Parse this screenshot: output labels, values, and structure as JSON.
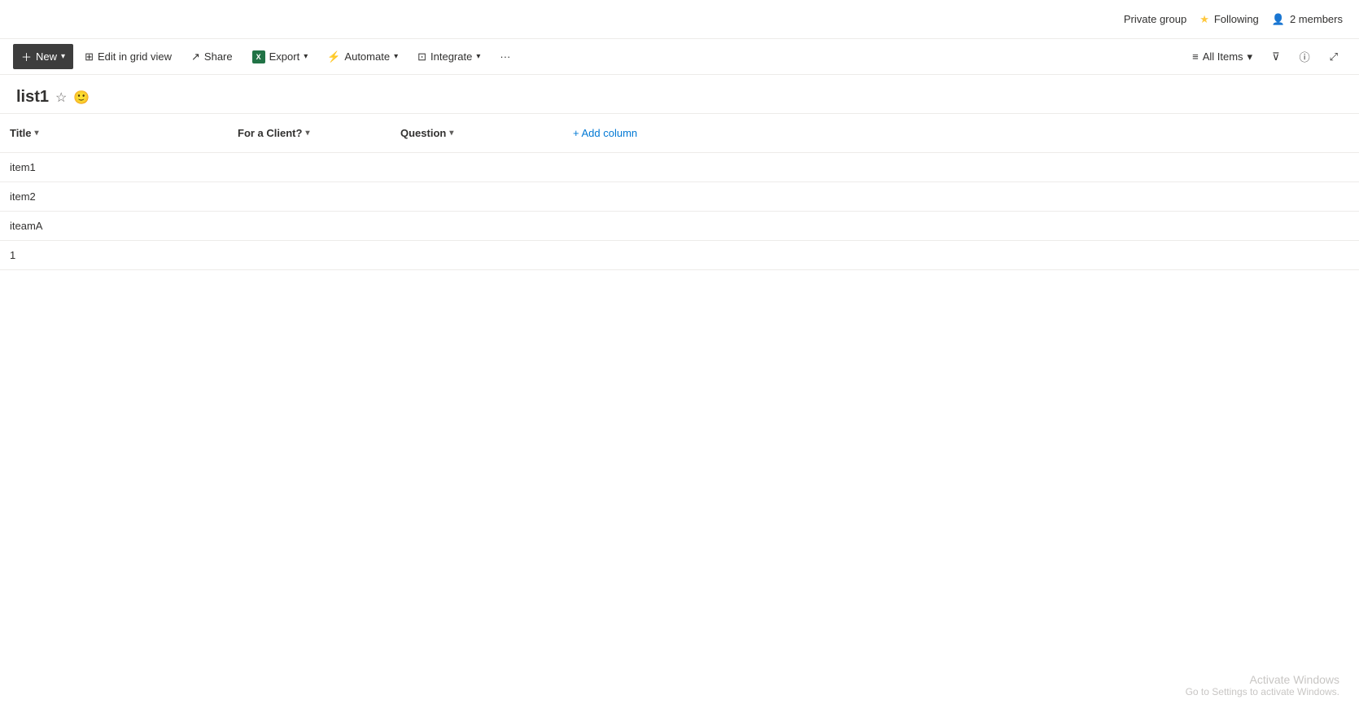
{
  "topbar": {
    "private_group_label": "Private group",
    "following_label": "Following",
    "members_label": "2 members"
  },
  "commandbar": {
    "new_label": "New",
    "edit_grid_label": "Edit in grid view",
    "share_label": "Share",
    "export_label": "Export",
    "automate_label": "Automate",
    "integrate_label": "Integrate",
    "more_label": "···",
    "all_items_label": "All Items"
  },
  "page": {
    "title": "list1"
  },
  "table": {
    "columns": [
      {
        "label": "Title"
      },
      {
        "label": "For a Client?"
      },
      {
        "label": "Question"
      }
    ],
    "add_column_label": "+ Add column",
    "rows": [
      {
        "title": "item1",
        "client": "",
        "question": ""
      },
      {
        "title": "item2",
        "client": "",
        "question": ""
      },
      {
        "title": "iteamA",
        "client": "",
        "question": ""
      },
      {
        "title": "1",
        "client": "",
        "question": ""
      }
    ]
  },
  "watermark": {
    "line1": "Activate Windows",
    "line2": "Go to Settings to activate Windows."
  }
}
